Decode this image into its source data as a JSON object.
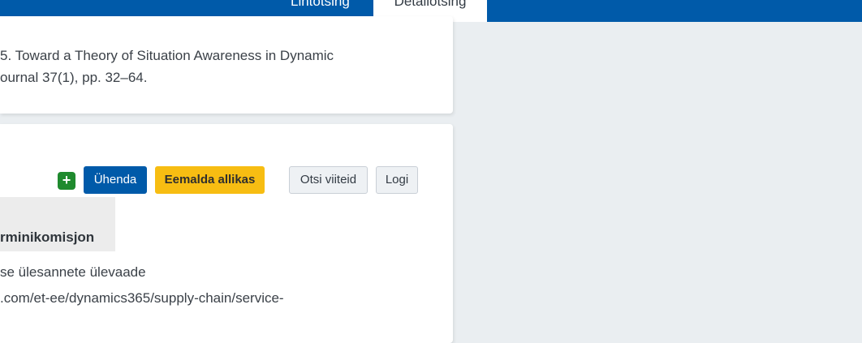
{
  "nav": {
    "tabs": [
      {
        "label": "Lihtotsing"
      },
      {
        "label": "Detailotsing"
      }
    ]
  },
  "reference": {
    "line1": "5. Toward a Theory of Situation Awareness in Dynamic",
    "line2": "ournal 37(1), pp. 32–64."
  },
  "toolbar": {
    "add_icon": "+",
    "merge_label": "Ühenda",
    "remove_source_label": "Eemalda allikas",
    "find_refs_label": "Otsi viiteid",
    "log_label": "Logi"
  },
  "source": {
    "name": "rminikomisjon"
  },
  "entry": {
    "line1": "se ülesannete ülevaade",
    "line2": ".com/et-ee/dynamics365/supply-chain/service-"
  },
  "colors": {
    "primary": "#005aa9",
    "warning": "#f7bd12",
    "success": "#1f8a2e",
    "background": "#eaeef1"
  }
}
